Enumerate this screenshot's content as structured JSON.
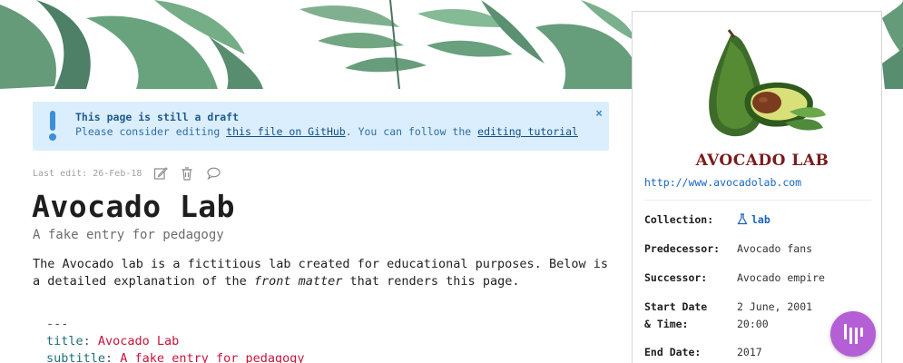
{
  "draft_notice": {
    "title": "This page is still a draft",
    "text_before": "Please consider editing ",
    "link1": "this file on GitHub",
    "text_middle": ". You can follow the ",
    "link2": "editing tutorial",
    "close": "×"
  },
  "meta": {
    "last_edit": "Last edit: 26-Feb-18",
    "icons": [
      "edit-icon",
      "delete-icon",
      "comment-icon"
    ]
  },
  "page": {
    "title": "Avocado Lab",
    "subtitle": "A fake entry for pedagogy",
    "intro_before": "The Avocado lab is a fictitious lab created for educational purposes. Below is a detailed explanation of the ",
    "intro_em": "front matter",
    "intro_after": " that renders this page."
  },
  "code": {
    "separator": "---",
    "lines": [
      {
        "key": "title",
        "value": "Avocado Lab"
      },
      {
        "key": "subtitle",
        "value": "A fake entry for pedagogy"
      }
    ]
  },
  "sidebar": {
    "logo_text": "AVOCADO LAB",
    "url": "http://www.avocadolab.com",
    "props": [
      {
        "label": "Collection:",
        "value": "lab"
      },
      {
        "label": "Predecessor:",
        "value": "Avocado fans"
      },
      {
        "label": "Successor:",
        "value": "Avocado empire"
      },
      {
        "label_line1": "Start Date",
        "label_line2": "& Time:",
        "value_line1": "2 June, 2001",
        "value_line2": "20:00"
      },
      {
        "label": "End Date:",
        "value": "2017"
      }
    ]
  },
  "colors": {
    "draft_bg": "#dbeefe",
    "accent_link": "#1565c0",
    "code_key": "#1f6d7a",
    "code_value": "#c8143a",
    "fab": "#b45fd6"
  }
}
